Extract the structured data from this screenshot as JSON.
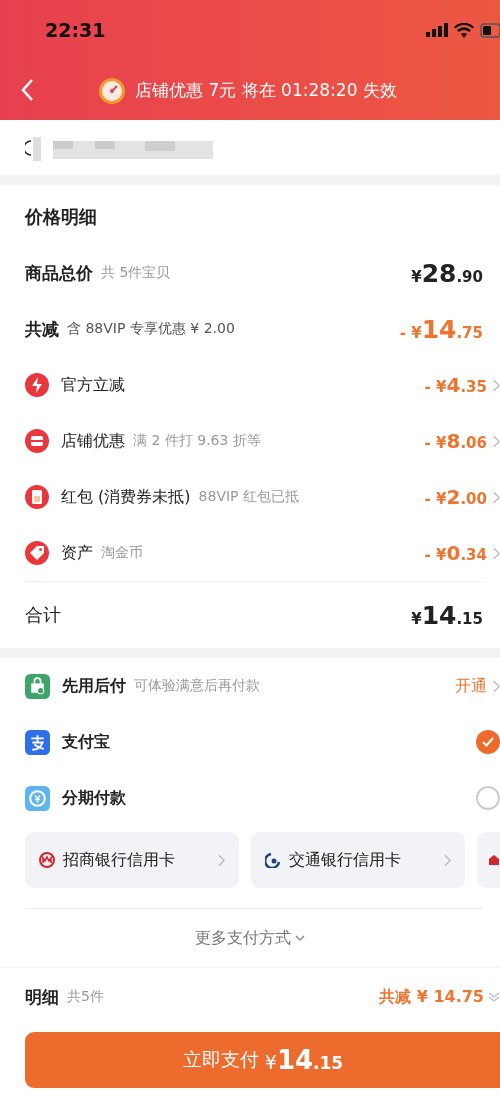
{
  "status_bar": {
    "time": "22:31"
  },
  "nav": {
    "banner": "店铺优惠 7元 将在 01:28:20 失效"
  },
  "price_detail": {
    "title": "价格明细",
    "subtotal": {
      "label": "商品总价",
      "note": "共 5件宝贝",
      "price": {
        "prefix": "¥",
        "int": "28",
        "dec": ".90"
      }
    },
    "discount_total": {
      "label": "共减",
      "note": "含 88VIP 专享优惠 ¥ 2.00",
      "price": {
        "prefix": "- ¥",
        "int": "14",
        "dec": ".75"
      }
    },
    "discounts": [
      {
        "label": "官方立减",
        "price": {
          "prefix": "- ¥",
          "int": "4",
          "dec": ".35"
        }
      },
      {
        "label": "店铺优惠",
        "note": "满 2 件打 9.63 折等",
        "price": {
          "prefix": "- ¥",
          "int": "8",
          "dec": ".06"
        }
      },
      {
        "label": "红包 (消费券未抵)",
        "note": "88VIP 红包已抵",
        "price": {
          "prefix": "- ¥",
          "int": "2",
          "dec": ".00"
        }
      },
      {
        "label": "资产",
        "note": "淘金币",
        "price": {
          "prefix": "- ¥",
          "int": "0",
          "dec": ".34"
        }
      }
    ],
    "total": {
      "label": "合计",
      "price": {
        "prefix": "¥",
        "int": "14",
        "dec": ".15"
      }
    }
  },
  "payment": {
    "methods": [
      {
        "kind": "promo",
        "label": "先用后付",
        "note": "可体验满意后再付款",
        "action": "开通"
      },
      {
        "kind": "radio",
        "label": "支付宝",
        "selected": true
      },
      {
        "kind": "radio",
        "label": "分期付款",
        "selected": false
      }
    ],
    "cards": [
      {
        "label": "招商银行信用卡"
      },
      {
        "label": "交通银行信用卡"
      }
    ],
    "more": "更多支付方式"
  },
  "footer": {
    "label": "明细",
    "count": "共5件",
    "savings": "共减 ¥ 14.75",
    "pay_button": {
      "label": "立即支付",
      "prefix": "¥",
      "int": "14",
      "dec": ".15"
    }
  }
}
